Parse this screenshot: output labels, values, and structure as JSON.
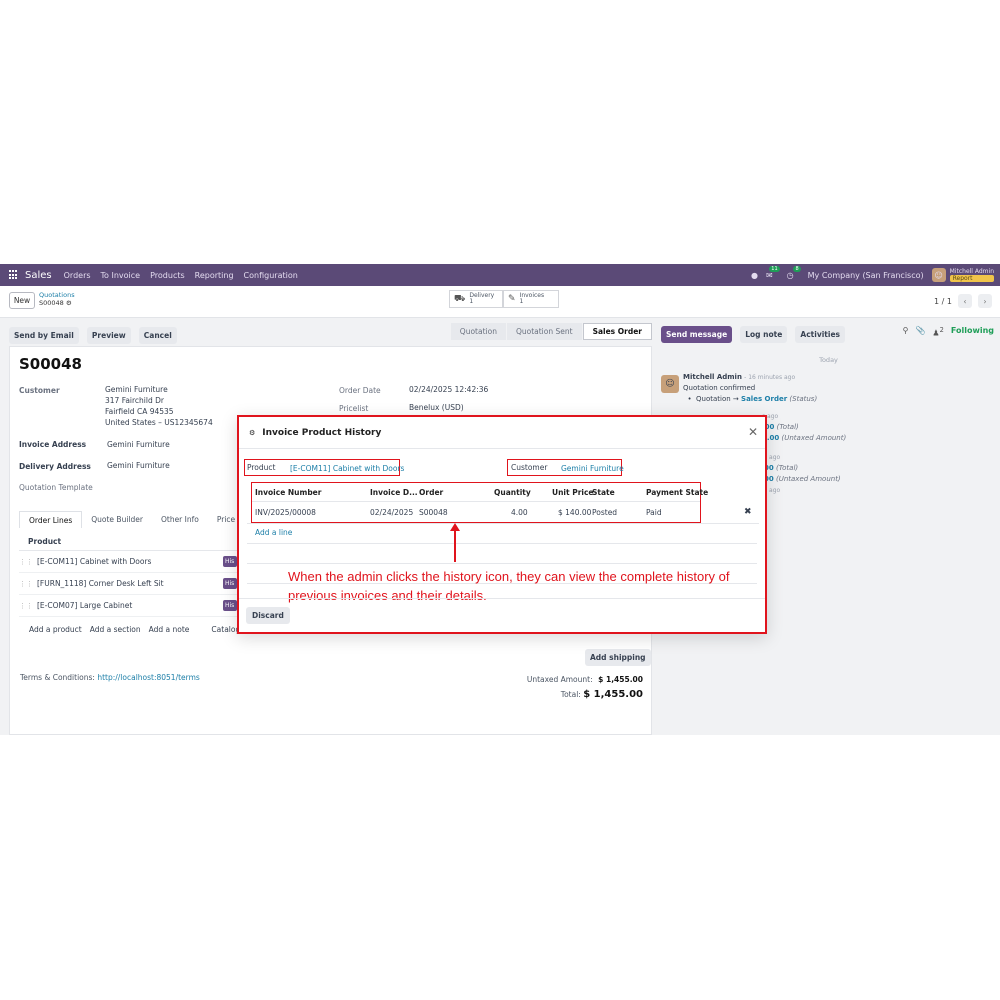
{
  "navbar": {
    "app": "Sales",
    "menu": [
      "Orders",
      "To Invoice",
      "Products",
      "Reporting",
      "Configuration"
    ],
    "chat_badge": "11",
    "activity_badge": "8",
    "company": "My Company (San Francisco)",
    "user": "Mitchell Admin",
    "user_sub": "Report"
  },
  "control": {
    "new_label": "New",
    "breadcrumb_parent": "Quotations",
    "breadcrumb_current": "S00048",
    "delivery_label": "Delivery",
    "delivery_count": "1",
    "invoices_label": "Invoices",
    "invoices_count": "1",
    "pager": "1 / 1"
  },
  "toolbar": {
    "send_email": "Send by Email",
    "preview": "Preview",
    "cancel": "Cancel",
    "statuses": [
      "Quotation",
      "Quotation Sent",
      "Sales Order"
    ]
  },
  "form": {
    "title": "S00048",
    "customer_label": "Customer",
    "customer_name": "Gemini Furniture",
    "address_line1": "317 Fairchild Dr",
    "address_line2": "Fairfield CA 94535",
    "address_line3": "United States – US12345674",
    "invoice_address_label": "Invoice Address",
    "invoice_address": "Gemini Furniture",
    "delivery_address_label": "Delivery Address",
    "delivery_address": "Gemini Furniture",
    "quotation_template_label": "Quotation Template",
    "order_date_label": "Order Date",
    "order_date": "02/24/2025 12:42:36",
    "pricelist_label": "Pricelist",
    "pricelist": "Benelux (USD)"
  },
  "tabs": [
    "Order Lines",
    "Quote Builder",
    "Other Info",
    "Price His"
  ],
  "order_lines": {
    "header": "Product",
    "rows": [
      "[E-COM11] Cabinet with Doors",
      "[FURN_1118] Corner Desk Left Sit",
      "[E-COM07] Large Cabinet"
    ],
    "his_label": "His",
    "adders": [
      "Add a product",
      "Add a section",
      "Add a note",
      "Catalog"
    ]
  },
  "footer": {
    "add_shipping": "Add shipping",
    "terms_label": "Terms & Conditions:",
    "terms_link": "http://localhost:8051/terms",
    "untaxed_label": "Untaxed Amount:",
    "untaxed_value": "$ 1,455.00",
    "total_label": "Total:",
    "total_value": "$ 1,455.00"
  },
  "chatter": {
    "send_message": "Send message",
    "log_note": "Log note",
    "activities": "Activities",
    "followers_count": "2",
    "following": "Following",
    "today": "Today",
    "author": "Mitchell Admin",
    "time": "- 16 minutes ago",
    "message": "Quotation confirmed",
    "change_from": "Quotation",
    "change_to": "Sales Order",
    "change_field": "(Status)",
    "partial_time1": "s ago",
    "partial_total1": ".00",
    "partial_total_label": "(Total)",
    "partial_untaxed1": "5.00",
    "partial_untaxed_label": "(Untaxed Amount)",
    "partial_time2": "s ago",
    "partial_total2": "00",
    "partial_untaxed2": "00",
    "partial_time3": "s ago"
  },
  "dialog": {
    "title": "Invoice Product History",
    "product_label": "Product",
    "product_value": "[E-COM11] Cabinet with Doors",
    "customer_label": "Customer",
    "customer_value": "Gemini Furniture",
    "columns": [
      "Invoice Number",
      "Invoice D...",
      "Order",
      "Quantity",
      "Unit Price",
      "State",
      "Payment State"
    ],
    "row": [
      "INV/2025/00008",
      "02/24/2025",
      "S00048",
      "4.00",
      "$ 140.00",
      "Posted",
      "Paid"
    ],
    "add_line": "Add a line",
    "annotation": "When the admin clicks the history icon, they can view the complete history of previous invoices and their details.",
    "discard": "Discard"
  },
  "colors": {
    "navbar": "#5b4a77",
    "primary": "#6a4f8a",
    "link": "#1d7fa8",
    "annotation": "#e0141d",
    "following": "#1f9e58"
  }
}
